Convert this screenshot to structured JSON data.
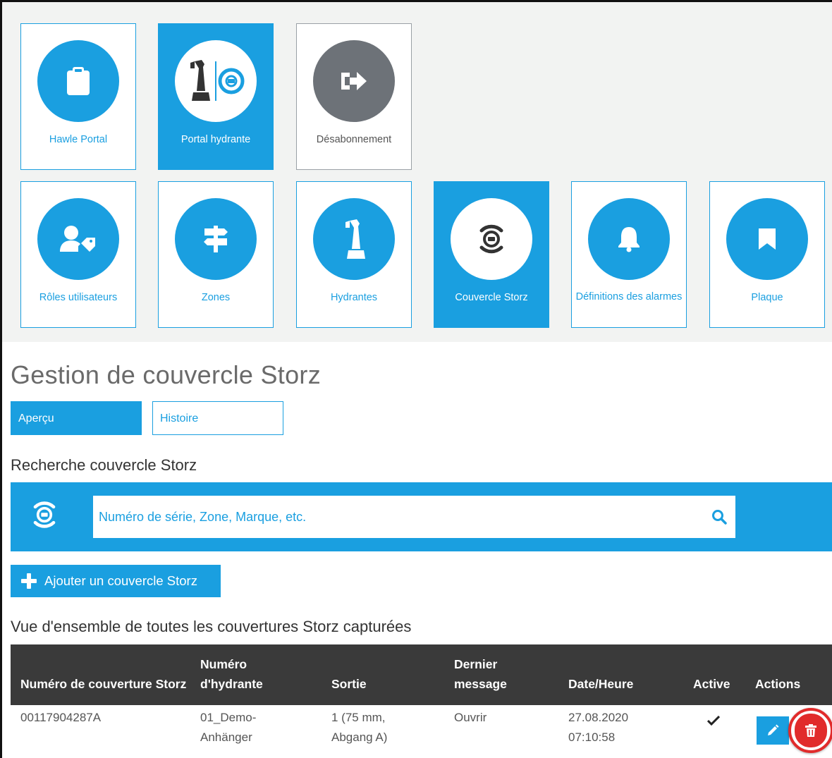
{
  "top_tiles": [
    {
      "label": "Hawle Portal",
      "icon": "clipboard-icon"
    },
    {
      "label": "Portal hydrante",
      "icon": "hydrant-storz-icon"
    },
    {
      "label": "Désabonnement",
      "icon": "sign-out-icon"
    }
  ],
  "nav_tiles": [
    {
      "label": "Rôles utilisateurs",
      "icon": "user-tag-icon"
    },
    {
      "label": "Zones",
      "icon": "signpost-icon"
    },
    {
      "label": "Hydrantes",
      "icon": "hydrant-icon"
    },
    {
      "label": "Couvercle Storz",
      "icon": "storz-cover-icon"
    },
    {
      "label": "Définitions des alarmes",
      "icon": "bell-icon"
    },
    {
      "label": "Plaque",
      "icon": "bookmark-icon"
    }
  ],
  "page": {
    "title": "Gestion de couvercle Storz",
    "tabs": [
      {
        "label": "Aperçu",
        "active": true
      },
      {
        "label": "Histoire",
        "active": false
      }
    ]
  },
  "search": {
    "heading": "Recherche couvercle Storz",
    "placeholder": "Numéro de série, Zone, Marque, etc."
  },
  "add_button": "Ajouter un couvercle Storz",
  "table": {
    "heading": "Vue d'ensemble de toutes les couvertures Storz capturées",
    "columns": [
      "Numéro de couverture Storz",
      "Numéro d'hydrante",
      "Sortie",
      "Dernier message",
      "Date/Heure",
      "Active",
      "Actions"
    ],
    "rows": [
      {
        "storz_number": "00117904287A",
        "hydrant_number": "01_Demo-Anhänger",
        "outlet": "1 (75 mm, Abgang A)",
        "last_message": "Ouvrir",
        "datetime": "27.08.2020 07:10:58",
        "active": true
      }
    ]
  },
  "colors": {
    "accent": "#1a9fe0",
    "dark_header": "#3a3a3a",
    "danger": "#e12b2b",
    "tile_bg": "#f2f3f2"
  }
}
